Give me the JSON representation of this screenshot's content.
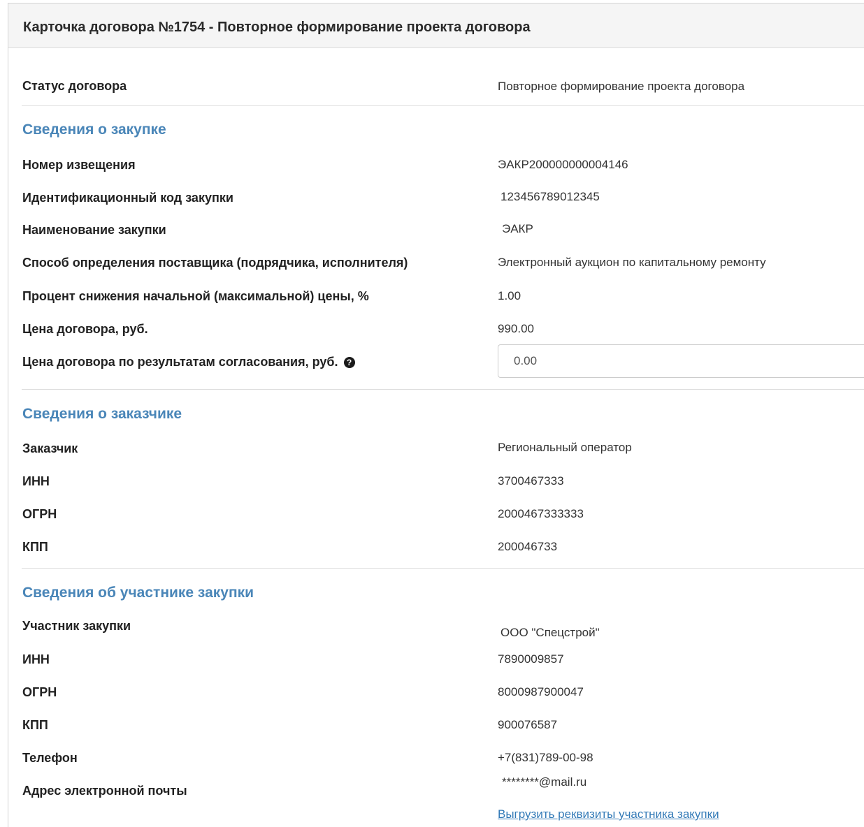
{
  "header": {
    "title": "Карточка договора №1754 - Повторное формирование проекта договора"
  },
  "status": {
    "label": "Статус договора",
    "value": "Повторное формирование проекта договора"
  },
  "purchase": {
    "heading": "Сведения о закупке",
    "notice_label": "Номер извещения",
    "notice_value": "ЭАКР200000000004146",
    "code_label": "Идентификационный код закупки",
    "code_value": "123456789012345",
    "name_label": "Наименование закупки",
    "name_value": "ЭАКР",
    "method_label": "Способ определения поставщика (подрядчика, исполнителя)",
    "method_value": "Электронный аукцион по капитальному ремонту",
    "reduction_label": "Процент снижения начальной (максимальной) цены, %",
    "reduction_value": "1.00",
    "price_label": "Цена договора, руб.",
    "price_value": "990.00",
    "agreed_price_label": "Цена договора по результатам согласования, руб.",
    "agreed_price_value": "0.00",
    "help_icon": "question-circle-icon",
    "help_glyph": "?"
  },
  "customer": {
    "heading": "Сведения о заказчике",
    "customer_label": "Заказчик",
    "customer_value": "Региональный оператор",
    "inn_label": "ИНН",
    "inn_value": "3700467333",
    "ogrn_label": "ОГРН",
    "ogrn_value": "2000467333333",
    "kpp_label": "КПП",
    "kpp_value": "200046733"
  },
  "participant": {
    "heading": "Сведения об участнике закупки",
    "participant_label": "Участник закупки",
    "participant_value": "ООО \"Спецстрой\"",
    "inn_label": "ИНН",
    "inn_value": "7890009857",
    "ogrn_label": "ОГРН",
    "ogrn_value": "8000987900047",
    "kpp_label": "КПП",
    "kpp_value": "900076587",
    "phone_label": "Телефон",
    "phone_value": "+7(831)789-00-98",
    "email_label": "Адрес электронной почты",
    "email_value": "********@mail.ru",
    "export_link": "Выгрузить реквизиты участника закупки"
  },
  "colors": {
    "section_heading": "#4a86b8",
    "link": "#337ab7",
    "header_bg": "#f5f5f5"
  }
}
